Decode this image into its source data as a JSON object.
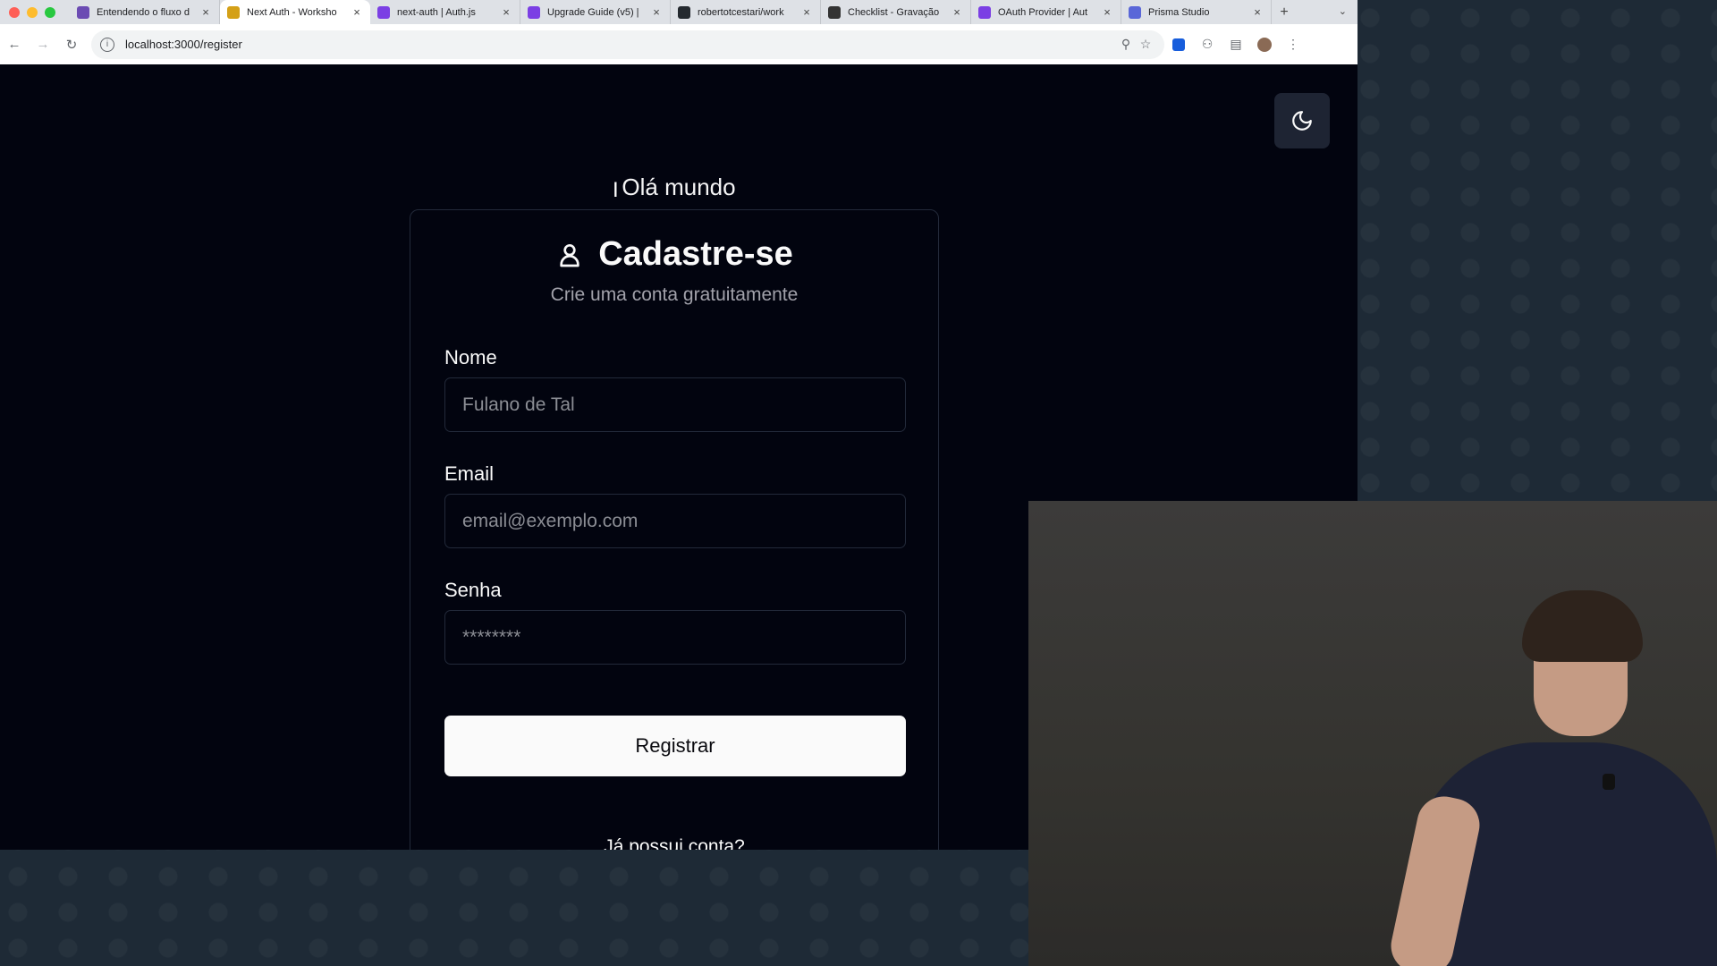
{
  "browser": {
    "tabs": [
      {
        "label": "Entendendo o fluxo d",
        "color": "#6b4bb3"
      },
      {
        "label": "Next Auth - Worksho",
        "color": "#d4a017",
        "active": true
      },
      {
        "label": "next-auth | Auth.js",
        "color": "#7b3fe4"
      },
      {
        "label": "Upgrade Guide (v5) |",
        "color": "#7b3fe4"
      },
      {
        "label": "robertotcestari/work",
        "color": "#24292f"
      },
      {
        "label": "Checklist - Gravação",
        "color": "#333333"
      },
      {
        "label": "OAuth Provider | Aut",
        "color": "#7b3fe4"
      },
      {
        "label": "Prisma Studio",
        "color": "#5a67d8"
      }
    ],
    "url": "localhost:3000/register"
  },
  "page": {
    "greeting": "Olá mundo",
    "card": {
      "title": "Cadastre-se",
      "subtitle": "Crie uma conta gratuitamente",
      "fields": {
        "name_label": "Nome",
        "name_placeholder": "Fulano de Tal",
        "email_label": "Email",
        "email_placeholder": "email@exemplo.com",
        "password_label": "Senha",
        "password_placeholder": "********"
      },
      "submit_label": "Registrar",
      "login_prompt": "Já possui conta?"
    }
  },
  "icons": {
    "theme_toggle": "moon-icon",
    "title_icon": "user-icon"
  },
  "colors": {
    "page_bg": "#02040f",
    "card_border": "#232a3a",
    "button_bg": "#fafafa"
  }
}
